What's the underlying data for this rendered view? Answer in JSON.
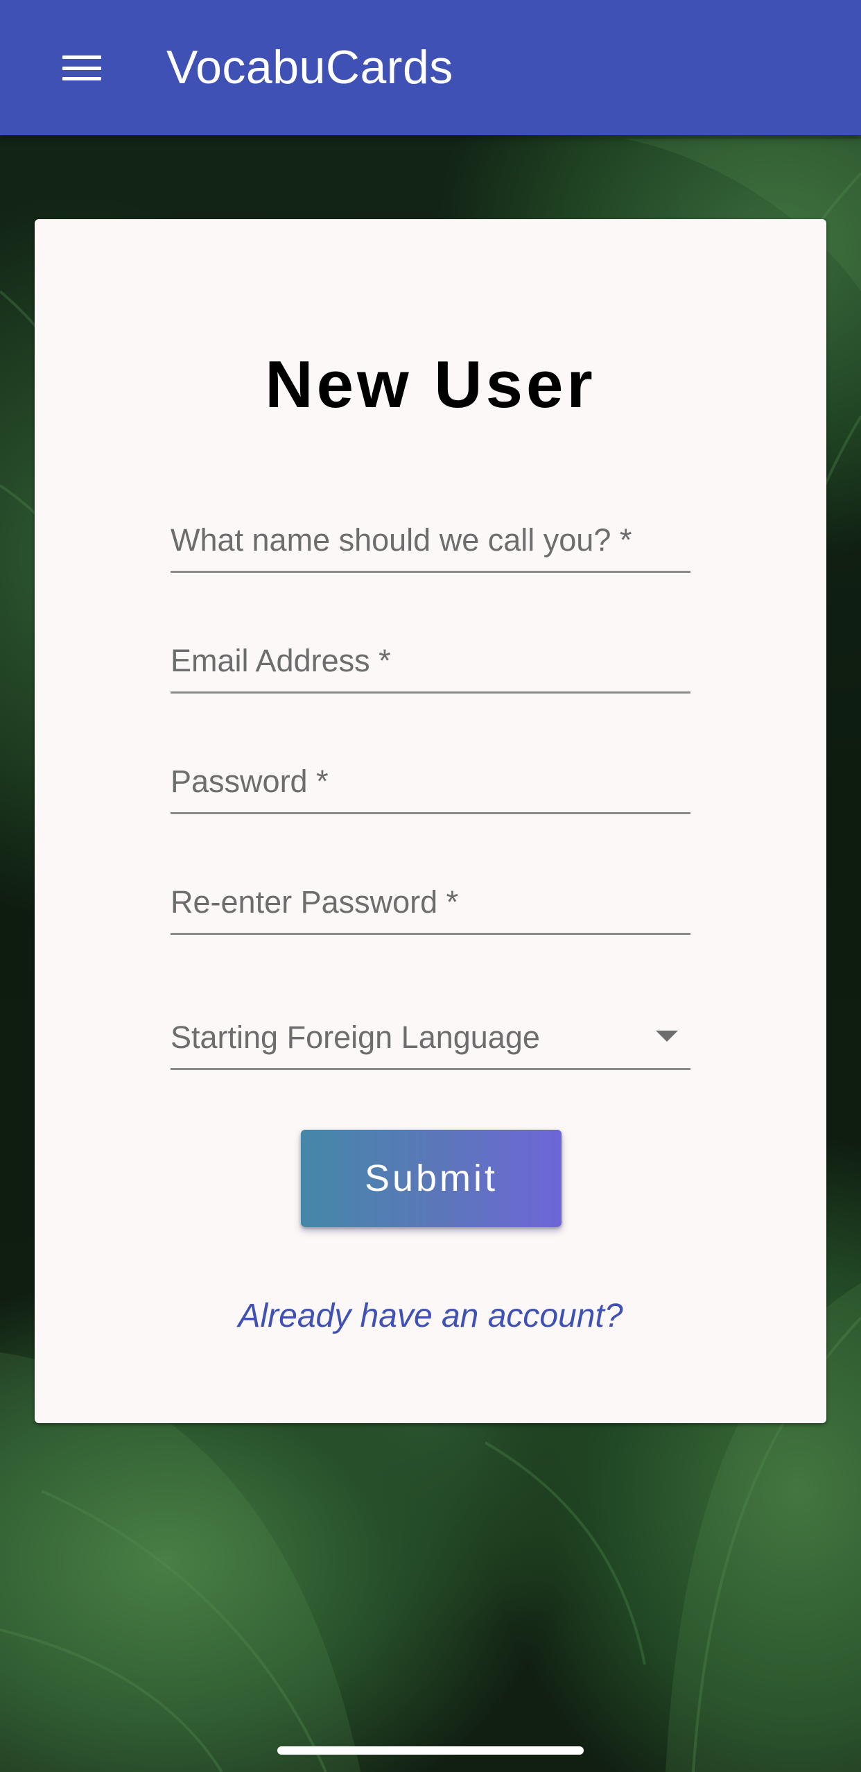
{
  "app_bar": {
    "menu_icon": "hamburger-menu-icon",
    "title": "VocabuCards",
    "color": "#3f51b5"
  },
  "background": {
    "description_icon": "leaves-background-image"
  },
  "form": {
    "title": "New User",
    "fields": {
      "name": {
        "label": "What name should we call you? *",
        "value": ""
      },
      "email": {
        "label": "Email Address *",
        "value": ""
      },
      "password": {
        "label": "Password *",
        "value": ""
      },
      "reenter_password": {
        "label": "Re-enter Password *",
        "value": ""
      }
    },
    "language_select": {
      "label": "Starting Foreign Language",
      "selected": "",
      "icon": "dropdown-arrow-icon"
    },
    "submit_label": "Submit",
    "login_link": "Already have an account?",
    "accent_color": "#3f51b5"
  }
}
